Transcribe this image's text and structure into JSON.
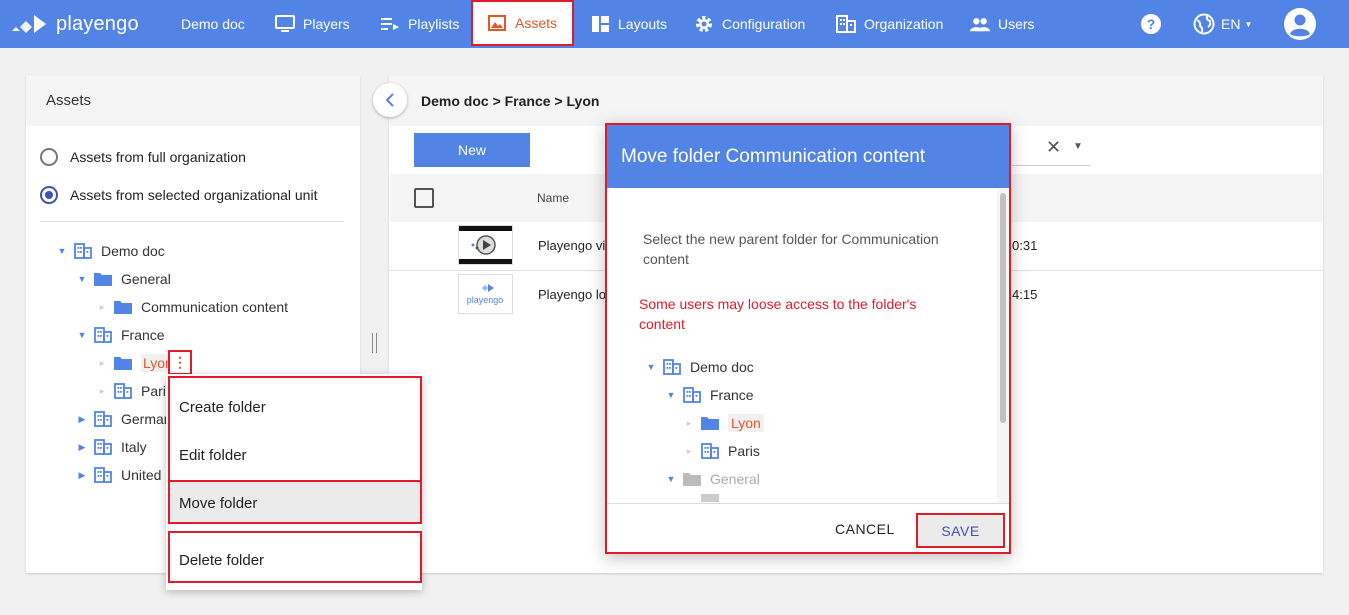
{
  "header": {
    "logo_text": "playengo",
    "nav": [
      {
        "label": "Demo doc",
        "icon": "none"
      },
      {
        "label": "Players",
        "icon": "monitor-icon"
      },
      {
        "label": "Playlists",
        "icon": "playlist-icon"
      },
      {
        "label": "Assets",
        "icon": "image-icon",
        "active": true
      },
      {
        "label": "Layouts",
        "icon": "layout-icon"
      },
      {
        "label": "Configuration",
        "icon": "gear-icon"
      },
      {
        "label": "Organization",
        "icon": "building-icon"
      },
      {
        "label": "Users",
        "icon": "users-icon"
      }
    ],
    "language": "EN"
  },
  "left_panel": {
    "title": "Assets",
    "radio_full": "Assets from full organization",
    "radio_selected": "Assets from selected organizational unit",
    "tree": {
      "demo_doc": "Demo doc",
      "general": "General",
      "communication": "Communication content",
      "france": "France",
      "lyon": "Lyon",
      "paris": "Pari",
      "germany": "Germar",
      "italy": "Italy",
      "uk": "United I"
    }
  },
  "context_menu": {
    "create": "Create folder",
    "edit": "Edit folder",
    "move": "Move folder",
    "delete": "Delete folder"
  },
  "main": {
    "breadcrumb": "Demo doc > France > Lyon",
    "new_button": "New",
    "col_name": "Name",
    "rows": [
      {
        "name": "Playengo vi",
        "time": "0:31"
      },
      {
        "name": "Playengo lo",
        "time": "4:15"
      }
    ],
    "thumb_logo": "playengo"
  },
  "modal": {
    "title": "Move folder Communication content",
    "description": "Select the new parent folder for Communication content",
    "warning": "Some users may loose access to the folder's content",
    "tree": {
      "demo_doc": "Demo doc",
      "france": "France",
      "lyon": "Lyon",
      "paris": "Paris",
      "general": "General"
    },
    "cancel": "CANCEL",
    "save": "SAVE"
  },
  "colors": {
    "brand": "#5284e6",
    "accent": "#e65728",
    "highlight": "#e01b2a"
  }
}
